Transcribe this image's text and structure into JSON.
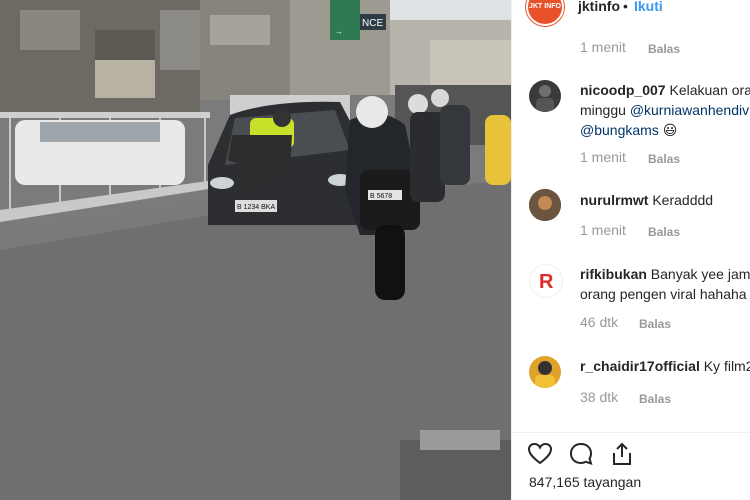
{
  "post": {
    "username": "jktinfo",
    "separator": "•",
    "follow_label": "Ikuti",
    "logo_text": "JKT INFO",
    "first_time": "1 menit",
    "first_reply": "Balas"
  },
  "comments": [
    {
      "user": "nicoodp_007",
      "line1_text": "Kelakuan oran",
      "line2_prefix": "minggu ",
      "line2_mention": "@kurniawanhendiv",
      "line3_mention": "@bungkams",
      "line3_emoji": "😃",
      "time": "1 menit",
      "reply": "Balas"
    },
    {
      "user": "nurulrmwt",
      "line1_text": "Keradddd",
      "time": "1 menit",
      "reply": "Balas"
    },
    {
      "user": "rifkibukan",
      "line1_text": "Banyak yee jama",
      "line2_prefix": "orang pengen viral hahaha",
      "time": "46 dtk",
      "reply": "Balas",
      "avatar_letter": "R"
    },
    {
      "user": "r_chaidir17official",
      "line1_text": "Ky film2",
      "time": "38 dtk",
      "reply": "Balas"
    }
  ],
  "photo": {
    "sign_text": "NCE",
    "plate_car": "B 1234 BKA",
    "plate_moto": "B 5678"
  },
  "views": "847,165 tayangan",
  "colors": {
    "accent": "#3897f0",
    "logo": "#e8522a"
  }
}
